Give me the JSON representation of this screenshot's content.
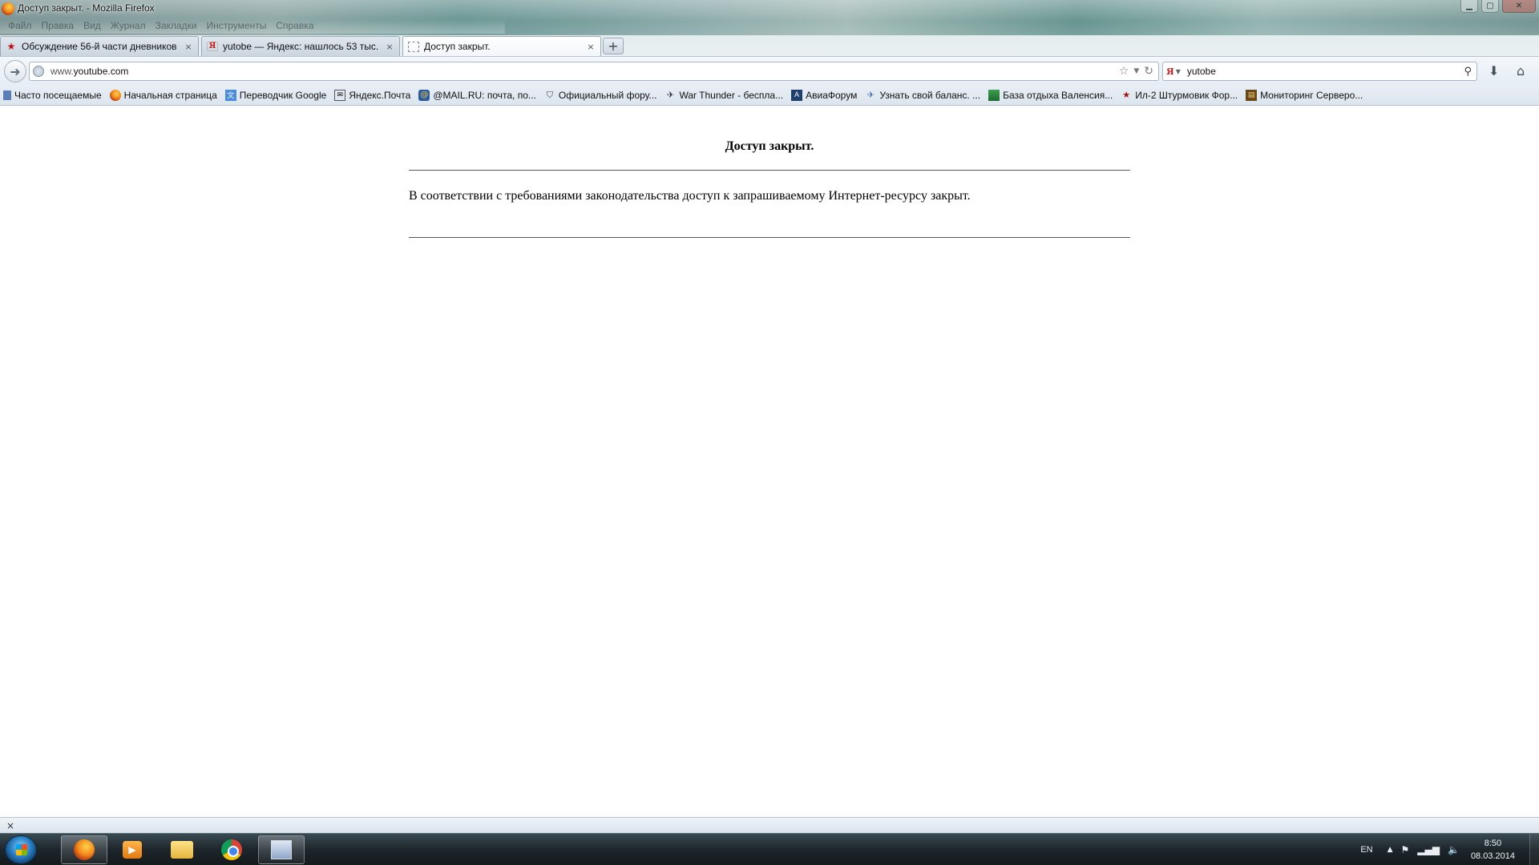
{
  "window": {
    "title": "Доступ закрыт. - Mozilla Firefox",
    "controls": {
      "minimize": "▁",
      "maximize": "▢",
      "close": "✕"
    }
  },
  "menu": [
    "Файл",
    "Правка",
    "Вид",
    "Журнал",
    "Закладки",
    "Инструменты",
    "Справка"
  ],
  "tabs": [
    {
      "label": "Обсуждение 56-й части дневников ...",
      "favicon": "red-star-icon",
      "active": false
    },
    {
      "label": "yutobe — Яндекс: нашлось 53 тыс. ...",
      "favicon": "yandex-icon",
      "active": false
    },
    {
      "label": "Доступ закрыт.",
      "favicon": "blank-page-icon",
      "active": true
    }
  ],
  "new_tab_label": "+",
  "tab_close_glyph": "×",
  "navigation": {
    "url_prefix": "www.",
    "url_domain": "youtube.com",
    "search_engine": "Я",
    "search_value": "yutobe"
  },
  "bookmarks": [
    {
      "label": "Часто посещаемые",
      "icon": "bookmark-folder-icon"
    },
    {
      "label": "Начальная страница",
      "icon": "firefox-icon"
    },
    {
      "label": "Переводчик Google",
      "icon": "google-translate-icon"
    },
    {
      "label": "Яндекс.Почта",
      "icon": "mail-icon"
    },
    {
      "label": "@MAIL.RU: почта, по...",
      "icon": "mailru-icon"
    },
    {
      "label": "Официальный фору...",
      "icon": "shield-icon"
    },
    {
      "label": "War Thunder - беспла...",
      "icon": "plane-icon"
    },
    {
      "label": "АвиаФорум",
      "icon": "aviaforum-icon"
    },
    {
      "label": "Узнать свой баланс. ...",
      "icon": "jet-icon"
    },
    {
      "label": "База отдыха Валенсия...",
      "icon": "resort-icon"
    },
    {
      "label": "Ил-2 Штурмовик Фор...",
      "icon": "red-star-icon"
    },
    {
      "label": "Мониторинг Серверо...",
      "icon": "monitor-icon"
    }
  ],
  "page": {
    "heading": "Доступ закрыт.",
    "message": "В соответствии с требованиями законодательства доступ к запрашиваемому Интернет-ресурсу закрыт."
  },
  "statusbar": {
    "close_glyph": "×"
  },
  "taskbar": {
    "language": "EN",
    "time": "8:50",
    "date": "08.03.2014"
  }
}
